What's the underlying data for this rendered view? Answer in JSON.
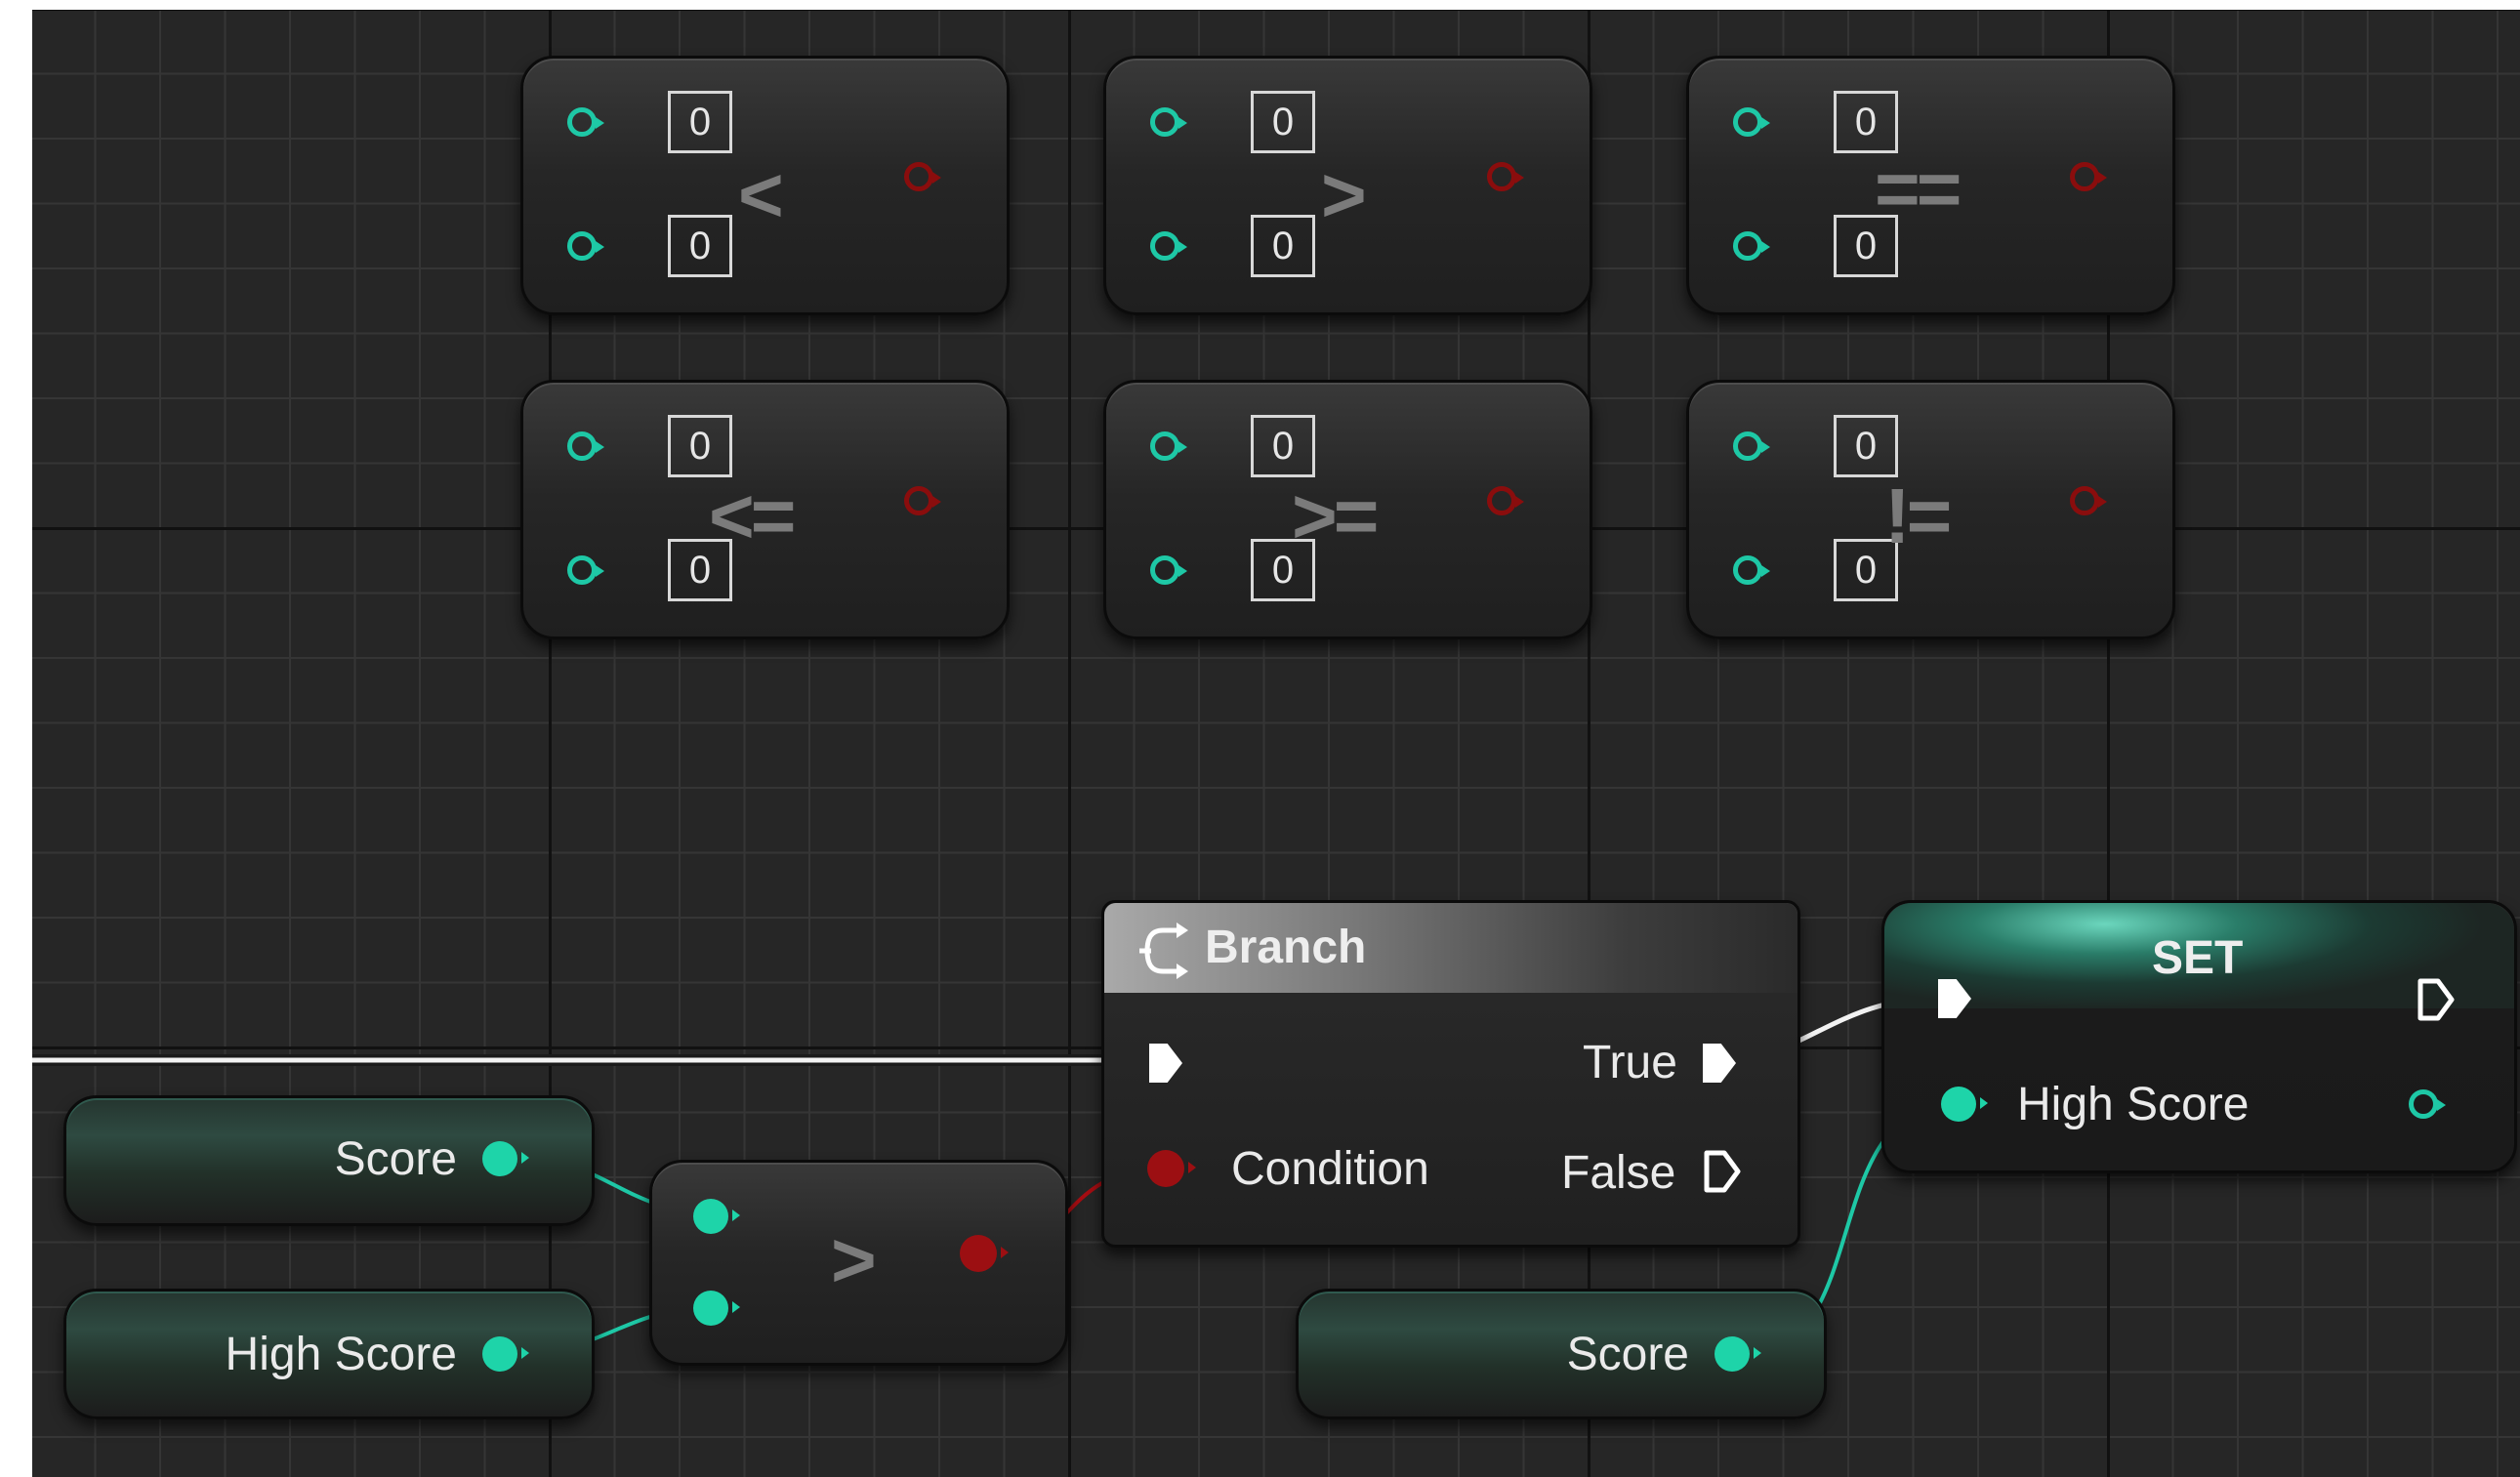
{
  "comparison_nodes": [
    {
      "operator": "<",
      "a": "0",
      "b": "0"
    },
    {
      "operator": ">",
      "a": "0",
      "b": "0"
    },
    {
      "operator": "==",
      "a": "0",
      "b": "0"
    },
    {
      "operator": "<=",
      "a": "0",
      "b": "0"
    },
    {
      "operator": ">=",
      "a": "0",
      "b": "0"
    },
    {
      "operator": "!=",
      "a": "0",
      "b": "0"
    }
  ],
  "branch": {
    "title": "Branch",
    "condition_label": "Condition",
    "true_label": "True",
    "false_label": "False"
  },
  "compare_node": {
    "operator": ">"
  },
  "set_node": {
    "title": "SET",
    "pin_label": "High Score"
  },
  "variables": {
    "score_top": "Score",
    "high_score": "High Score",
    "score_bottom": "Score"
  },
  "colors": {
    "grid_bg": "#262626",
    "int_pin": "#1ed4a9",
    "bool_pin": "#9c0f12",
    "exec": "#ffffff"
  }
}
